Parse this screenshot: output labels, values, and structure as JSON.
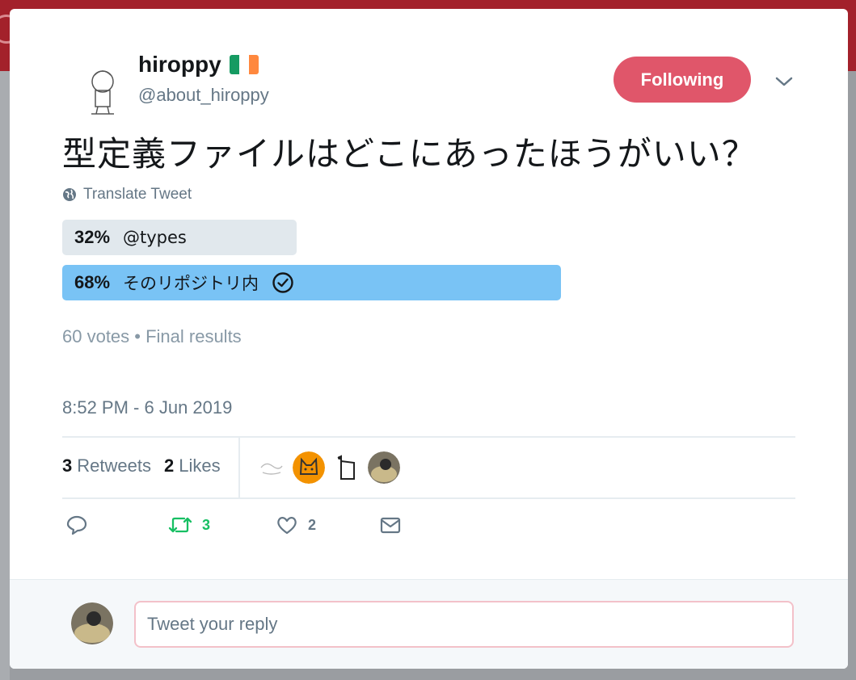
{
  "user": {
    "name": "hiroppy",
    "handle": "@about_hiroppy",
    "flag_colors": [
      "#169b62",
      "#ffffff",
      "#ff883e"
    ]
  },
  "follow_button": {
    "label": "Following",
    "color": "#e0566a"
  },
  "tweet": {
    "text": "型定義ファイルはどこにあったほうがいい？",
    "translate_label": "Translate Tweet"
  },
  "poll": {
    "options": [
      {
        "percent_label": "32%",
        "label": "@types",
        "fraction": 0.32,
        "winner": false
      },
      {
        "percent_label": "68%",
        "label": "そのリポジトリ内",
        "fraction": 0.68,
        "winner": true
      }
    ],
    "meta": "60 votes • Final results"
  },
  "timestamp": "8:52 PM - 6 Jun 2019",
  "stats": {
    "retweets_count": "3",
    "retweets_label": "Retweets",
    "likes_count": "2",
    "likes_label": "Likes"
  },
  "actions": {
    "reply_icon": "reply-icon",
    "retweet_icon": "retweet-icon",
    "retweet_count": "3",
    "like_icon": "heart-icon",
    "like_count": "2",
    "dm_icon": "envelope-icon"
  },
  "reply": {
    "placeholder": "Tweet your reply"
  },
  "colors": {
    "accent": "#e0566a",
    "poll_winner": "#79c3f5",
    "poll_other": "#e1e8ed",
    "retweet_green": "#17bf63",
    "text_secondary": "#657786"
  }
}
